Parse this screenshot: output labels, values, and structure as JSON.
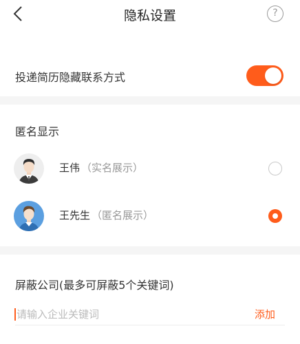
{
  "header": {
    "title": "隐私设置",
    "back_icon": "chevron-left-icon",
    "help_icon": "question-circle-icon",
    "help_glyph": "?"
  },
  "resume_setting": {
    "label": "投递简历隐藏联系方式",
    "toggle_on": true,
    "accent_color": "#ff5c1b"
  },
  "anonymous": {
    "title": "匿名显示",
    "options": [
      {
        "name": "王伟",
        "hint": "（实名展示）",
        "selected": false,
        "avatar": "user-avatar-realname"
      },
      {
        "name": "王先生",
        "hint": "（匿名展示）",
        "selected": true,
        "avatar": "user-avatar-anonymous"
      }
    ]
  },
  "block_company": {
    "title": "屏蔽公司(最多可屏蔽5个关键词)",
    "placeholder": "请输入企业关键词",
    "value": "",
    "add_label": "添加"
  }
}
